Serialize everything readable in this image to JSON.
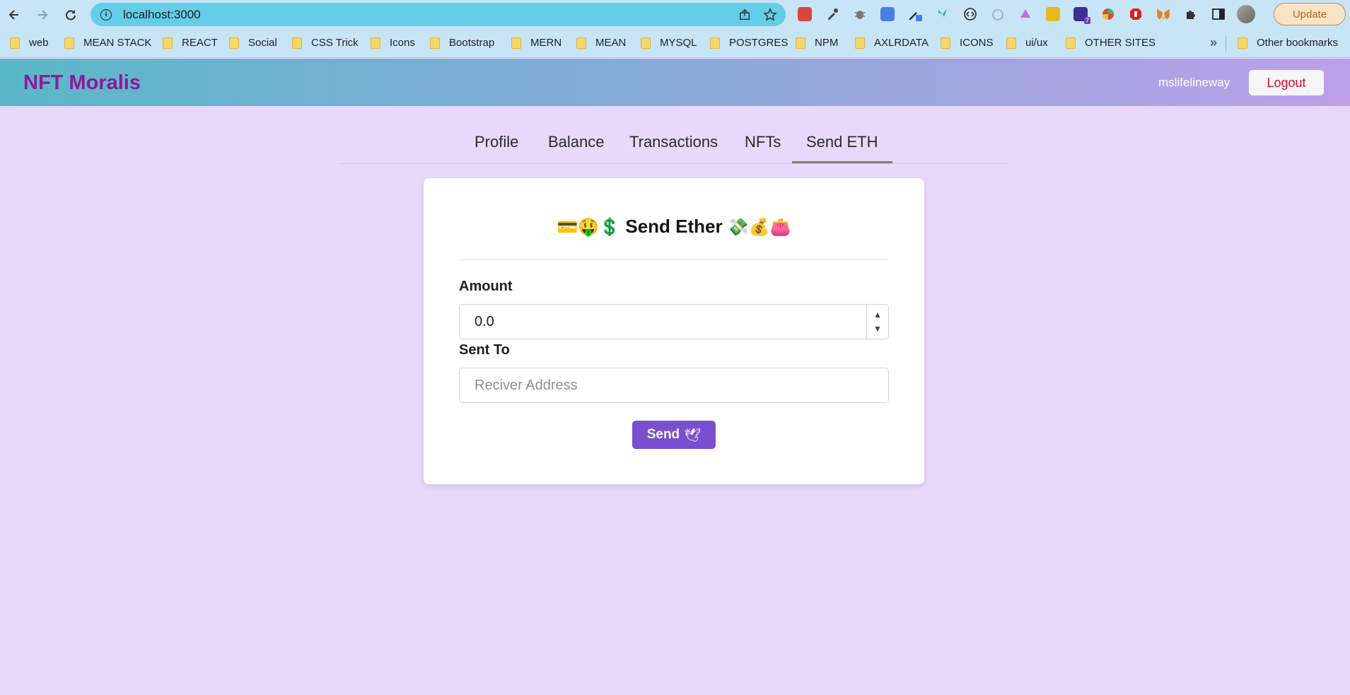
{
  "browser": {
    "url": "localhost:3000",
    "update_label": "Update",
    "bookmarks_more": "»",
    "bookmarks": [
      {
        "label": "web"
      },
      {
        "label": "MEAN STACK"
      },
      {
        "label": "REACT"
      },
      {
        "label": "Social"
      },
      {
        "label": "CSS Trick"
      },
      {
        "label": "Icons"
      },
      {
        "label": "Bootstrap"
      },
      {
        "label": "MERN"
      },
      {
        "label": "MEAN"
      },
      {
        "label": "MYSQL"
      },
      {
        "label": "POSTGRES"
      },
      {
        "label": "NPM"
      },
      {
        "label": "AXLRDATA"
      },
      {
        "label": "ICONS"
      },
      {
        "label": "ui/ux"
      },
      {
        "label": "OTHER SITES"
      }
    ],
    "other_bookmarks": "Other bookmarks",
    "extension_badge": "7"
  },
  "header": {
    "brand": "NFT Moralis",
    "username": "mslifelineway",
    "logout_label": "Logout"
  },
  "tabs": [
    {
      "label": "Profile",
      "active": false
    },
    {
      "label": "Balance",
      "active": false
    },
    {
      "label": "Transactions",
      "active": false
    },
    {
      "label": "NFTs",
      "active": false
    },
    {
      "label": "Send ETH",
      "active": true
    }
  ],
  "form": {
    "title_prefix_emoji": "💳🤑💲",
    "title": "Send Ether",
    "title_suffix_emoji": "💸💰👛",
    "amount_label": "Amount",
    "amount_value": "0.0",
    "sent_to_label": "Sent To",
    "address_placeholder": "Reciver Address",
    "send_label": "Send",
    "send_emoji": "🕊"
  },
  "colors": {
    "page_bg": "#e8d9fc",
    "brand": "#8b1a9a",
    "logout_text": "#e00b2d",
    "send_button": "#7a4fcf",
    "omnibox": "#64cde8"
  }
}
